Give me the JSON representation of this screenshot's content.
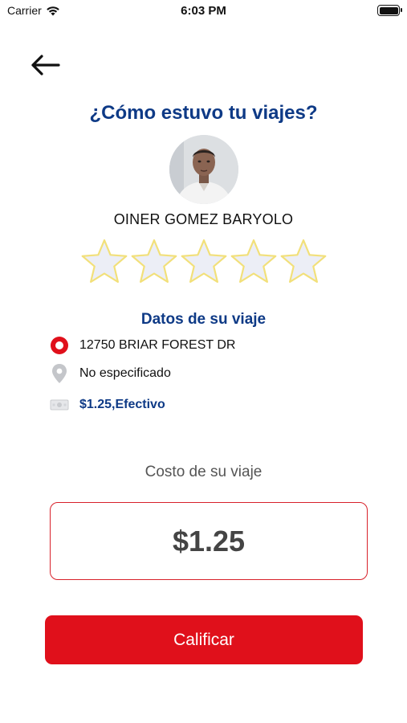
{
  "status_bar": {
    "carrier": "Carrier",
    "time": "6:03 PM"
  },
  "header": {
    "back_icon": "arrow-left-icon"
  },
  "title": "¿Cómo estuvo tu viajes?",
  "driver": {
    "name": "OINER GOMEZ BARYOLO"
  },
  "rating": {
    "max_stars": 5,
    "selected": 0
  },
  "trip": {
    "section_title": "Datos de su viaje",
    "origin": "12750 BRIAR FOREST DR",
    "destination": "No especificado",
    "payment": "$1.25,Efectivo"
  },
  "cost": {
    "label": "Costo de su viaje",
    "value": "$1.25"
  },
  "actions": {
    "rate_label": "Calificar"
  },
  "colors": {
    "title_blue": "#0e3a86",
    "accent_red": "#e0101b",
    "star_fill": "#eceef6",
    "star_outline": "#f2e07a"
  }
}
